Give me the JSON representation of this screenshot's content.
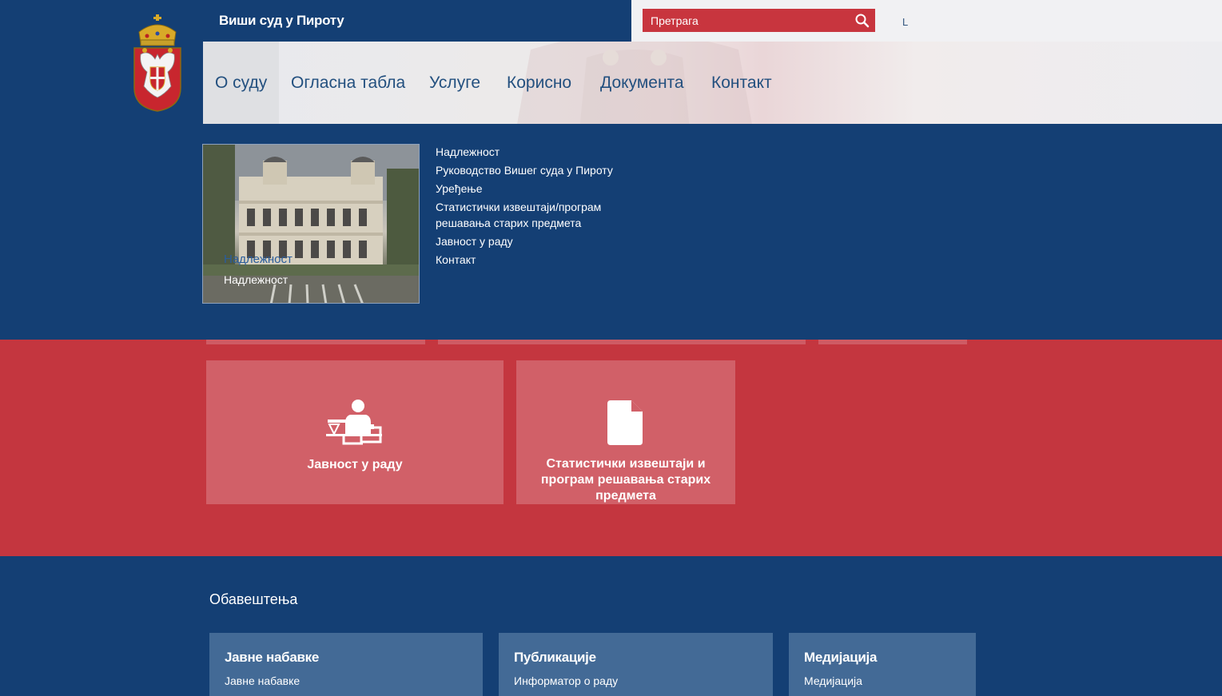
{
  "header": {
    "site_title": "Виши суд у Пироту",
    "search_placeholder": "Претрага",
    "lang_label": "L"
  },
  "nav": {
    "items": [
      {
        "label": "О суду"
      },
      {
        "label": "Огласна табла"
      },
      {
        "label": "Услуге"
      },
      {
        "label": "Корисно"
      },
      {
        "label": "Документа"
      },
      {
        "label": "Контакт"
      }
    ]
  },
  "mega_menu": {
    "photo_caption_ghost": "Надлежност",
    "photo_caption": "Надлежност",
    "links": [
      "Надлежност",
      "Руководство Вишег суда у Пироту",
      "Уређење",
      "Статистички извештаји/програм решавања старих предмета",
      "Јавност у раду",
      "Контакт"
    ]
  },
  "tiles": [
    {
      "label": "Јавност у раду",
      "icon": "judge-scales-icon"
    },
    {
      "label": "Статистички извештаји и програм решавања старих предмета",
      "icon": "document-icon"
    }
  ],
  "notices": {
    "title": "Обавештења",
    "cards": [
      {
        "title": "Јавне набавке",
        "link": "Јавне набавке"
      },
      {
        "title": "Публикације",
        "link": "Информатор о раду"
      },
      {
        "title": "Медијација",
        "link": "Медијација"
      }
    ]
  },
  "colors": {
    "primary_blue": "#143f74",
    "accent_red": "#c4363f",
    "tile_red": "#d16068",
    "card_blue": "#436a96"
  }
}
